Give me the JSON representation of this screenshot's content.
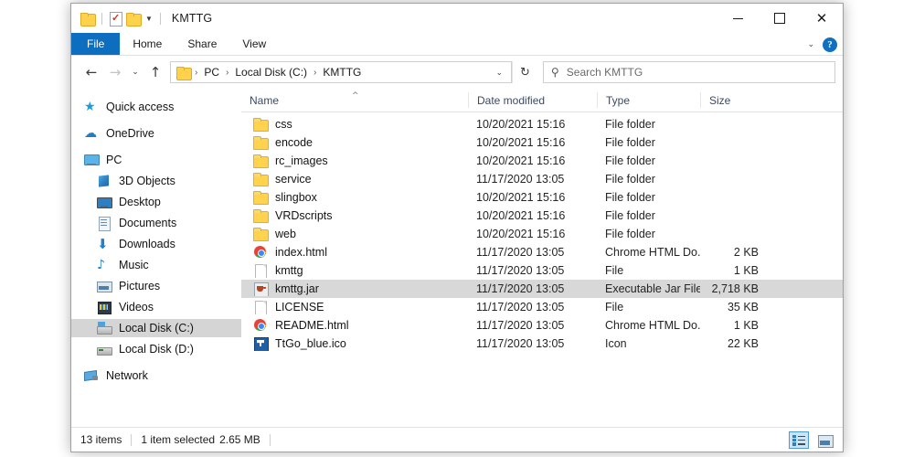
{
  "window": {
    "title": "KMTTG",
    "quick_access_icons": [
      "folder-icon",
      "properties-icon",
      "new-folder-icon",
      "customize-chevron-icon"
    ],
    "controls": {
      "minimize": "–",
      "maximize": "□",
      "close": "✕"
    }
  },
  "ribbon": {
    "tabs": [
      {
        "label": "File",
        "active": true
      },
      {
        "label": "Home",
        "active": false
      },
      {
        "label": "Share",
        "active": false
      },
      {
        "label": "View",
        "active": false
      }
    ],
    "collapse_chevron": "⌄",
    "help_label": "?"
  },
  "address_bar": {
    "back": "←",
    "forward": "→",
    "recent_chevron": "⌄",
    "up": "↑",
    "crumbs": [
      "PC",
      "Local Disk (C:)",
      "KMTTG"
    ],
    "separator": "›",
    "dropdown_chevron": "⌄",
    "refresh": "↻"
  },
  "search": {
    "icon": "search-icon",
    "placeholder": "Search KMTTG",
    "value": ""
  },
  "sidebar": {
    "items": [
      {
        "label": "Quick access",
        "icon": "star-icon",
        "indent": false,
        "selected": false,
        "gap": false
      },
      {
        "label": "OneDrive",
        "icon": "cloud-icon",
        "indent": false,
        "selected": false,
        "gap": true
      },
      {
        "label": "PC",
        "icon": "monitor-icon",
        "indent": false,
        "selected": false,
        "gap": true
      },
      {
        "label": "3D Objects",
        "icon": "cube-icon",
        "indent": true,
        "selected": false,
        "gap": false
      },
      {
        "label": "Desktop",
        "icon": "desktop-icon",
        "indent": true,
        "selected": false,
        "gap": false
      },
      {
        "label": "Documents",
        "icon": "documents-icon",
        "indent": true,
        "selected": false,
        "gap": false
      },
      {
        "label": "Downloads",
        "icon": "download-icon",
        "indent": true,
        "selected": false,
        "gap": false
      },
      {
        "label": "Music",
        "icon": "music-icon",
        "indent": true,
        "selected": false,
        "gap": false
      },
      {
        "label": "Pictures",
        "icon": "pictures-icon",
        "indent": true,
        "selected": false,
        "gap": false
      },
      {
        "label": "Videos",
        "icon": "videos-icon",
        "indent": true,
        "selected": false,
        "gap": false
      },
      {
        "label": "Local Disk (C:)",
        "icon": "harddrive-system-icon",
        "indent": true,
        "selected": true,
        "gap": false
      },
      {
        "label": "Local Disk (D:)",
        "icon": "harddrive-icon",
        "indent": true,
        "selected": false,
        "gap": false
      },
      {
        "label": "Network",
        "icon": "network-icon",
        "indent": false,
        "selected": false,
        "gap": true
      }
    ]
  },
  "file_list": {
    "columns": [
      "Name",
      "Date modified",
      "Type",
      "Size"
    ],
    "sort_column": "Name",
    "sort_indicator": "^",
    "rows": [
      {
        "name": "css",
        "date": "10/20/2021 15:16",
        "type": "File folder",
        "size": "",
        "icon": "folder-icon",
        "selected": false
      },
      {
        "name": "encode",
        "date": "10/20/2021 15:16",
        "type": "File folder",
        "size": "",
        "icon": "folder-icon",
        "selected": false
      },
      {
        "name": "rc_images",
        "date": "10/20/2021 15:16",
        "type": "File folder",
        "size": "",
        "icon": "folder-icon",
        "selected": false
      },
      {
        "name": "service",
        "date": "11/17/2020 13:05",
        "type": "File folder",
        "size": "",
        "icon": "folder-icon",
        "selected": false
      },
      {
        "name": "slingbox",
        "date": "10/20/2021 15:16",
        "type": "File folder",
        "size": "",
        "icon": "folder-icon",
        "selected": false
      },
      {
        "name": "VRDscripts",
        "date": "10/20/2021 15:16",
        "type": "File folder",
        "size": "",
        "icon": "folder-icon",
        "selected": false
      },
      {
        "name": "web",
        "date": "10/20/2021 15:16",
        "type": "File folder",
        "size": "",
        "icon": "folder-icon",
        "selected": false
      },
      {
        "name": "index.html",
        "date": "11/17/2020 13:05",
        "type": "Chrome HTML Do...",
        "size": "2 KB",
        "icon": "chrome-icon",
        "selected": false
      },
      {
        "name": "kmttg",
        "date": "11/17/2020 13:05",
        "type": "File",
        "size": "1 KB",
        "icon": "blank-file-icon",
        "selected": false
      },
      {
        "name": "kmttg.jar",
        "date": "11/17/2020 13:05",
        "type": "Executable Jar File",
        "size": "2,718 KB",
        "icon": "java-jar-icon",
        "selected": true
      },
      {
        "name": "LICENSE",
        "date": "11/17/2020 13:05",
        "type": "File",
        "size": "35 KB",
        "icon": "blank-file-icon",
        "selected": false
      },
      {
        "name": "README.html",
        "date": "11/17/2020 13:05",
        "type": "Chrome HTML Do...",
        "size": "1 KB",
        "icon": "chrome-icon",
        "selected": false
      },
      {
        "name": "TtGo_blue.ico",
        "date": "11/17/2020 13:05",
        "type": "Icon",
        "size": "22 KB",
        "icon": "tivo-ico-icon",
        "selected": false
      }
    ]
  },
  "status_bar": {
    "item_count": "13 items",
    "selection": "1 item selected",
    "selection_size": "2.65 MB",
    "view_buttons": [
      {
        "name": "details-view",
        "active": true
      },
      {
        "name": "large-icons-view",
        "active": false
      }
    ]
  },
  "colors": {
    "accent": "#0d6ebf",
    "selection": "#d8d8d8",
    "folder": "#ffd34e",
    "header_text": "#3b4a63"
  }
}
